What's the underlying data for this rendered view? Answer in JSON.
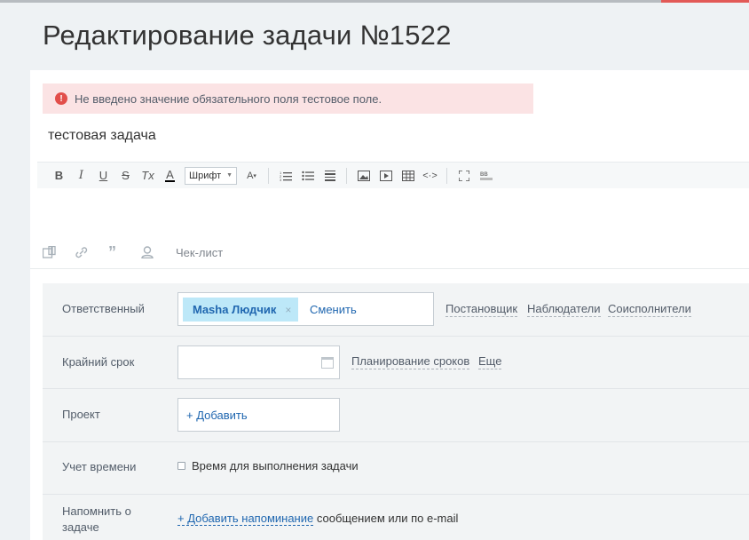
{
  "page": {
    "title": "Редактирование задачи №1522"
  },
  "error": {
    "icon": "exclamation-icon",
    "message": "Не введено значение обязательного поля тестовое поле."
  },
  "task": {
    "title": "тестовая задача"
  },
  "toolbar": {
    "bold": "B",
    "italic": "I",
    "underline": "U",
    "strike": "S",
    "clear_format": "Tx",
    "font_color": "A",
    "font_select": "Шрифт",
    "font_size": "A"
  },
  "bottom_bar": {
    "checklist_label": "Чек-лист"
  },
  "form": {
    "responsible": {
      "label": "Ответственный",
      "user": "Masha Людчик",
      "remove": "×",
      "change": "Сменить",
      "links": [
        "Постановщик",
        "Наблюдатели",
        "Соисполнители"
      ]
    },
    "deadline": {
      "label": "Крайний срок",
      "value": "",
      "planning": "Планирование сроков",
      "more": "Еще"
    },
    "project": {
      "label": "Проект",
      "add": "+ Добавить"
    },
    "time_tracking": {
      "label": "Учет времени",
      "checkbox_label": "Время для выполнения задачи",
      "checked": false
    },
    "reminder": {
      "label": "Напомнить о задаче",
      "add": "+ Добавить напоминание",
      "suffix": " сообщением или по e-mail"
    }
  },
  "colors": {
    "accent": "#2067b0",
    "error_bg": "#fbe3e4",
    "error_icon": "#e24e4a",
    "chip_bg": "#bde8f8"
  }
}
